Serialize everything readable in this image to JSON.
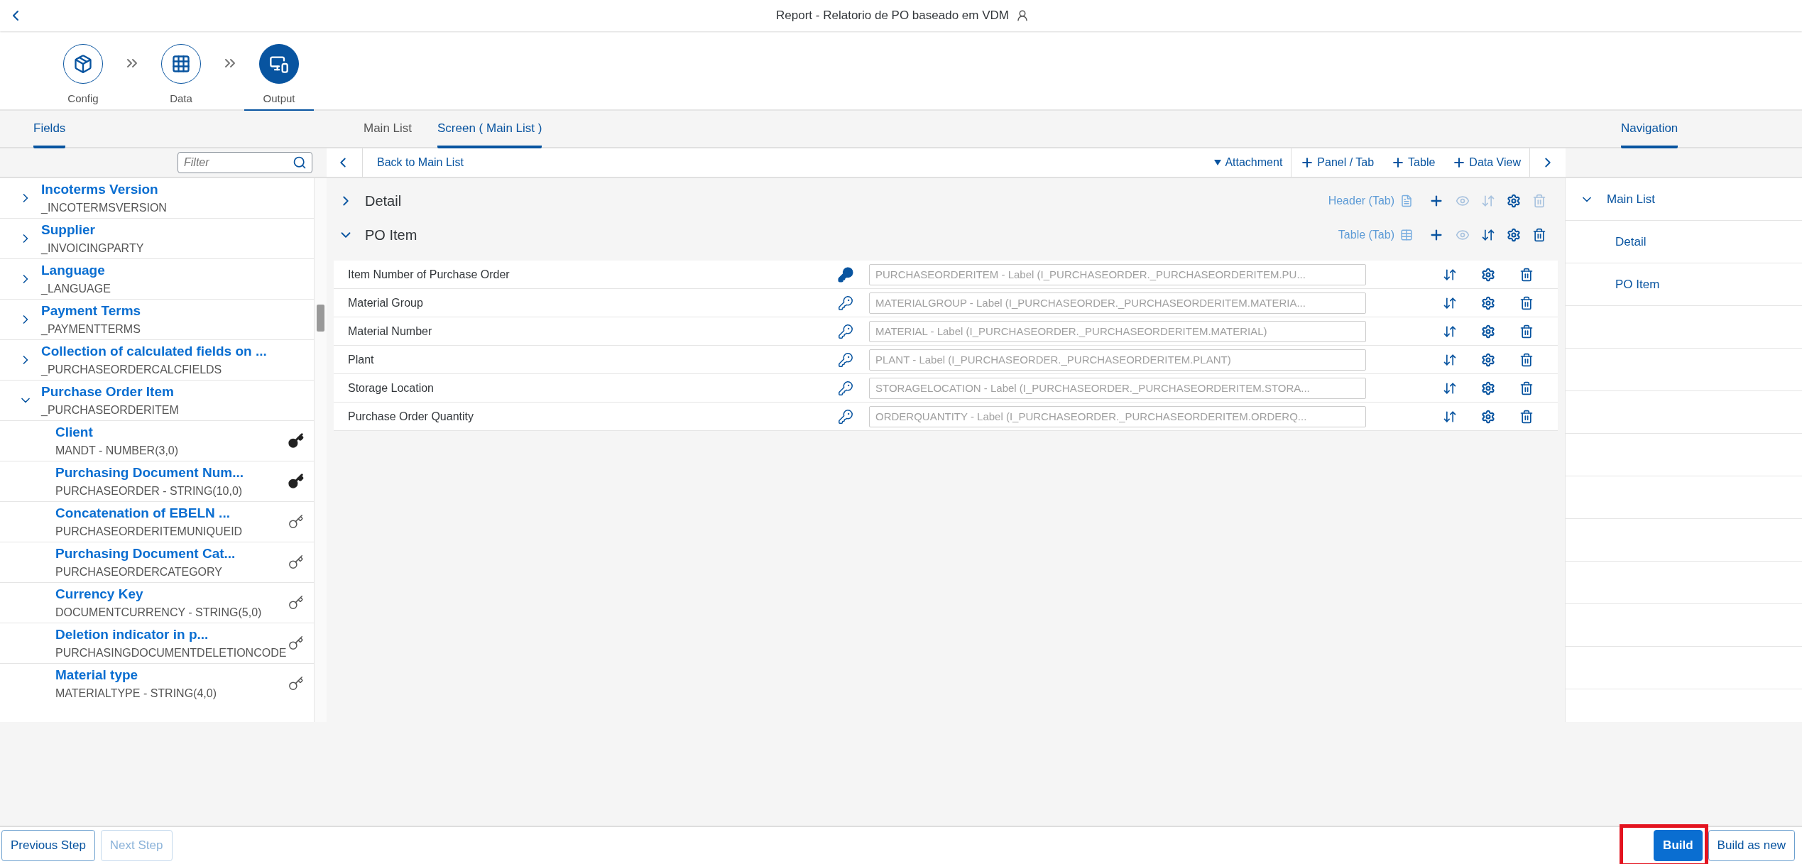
{
  "window": {
    "title": "Report - Relatorio de PO baseado em VDM"
  },
  "wizard": {
    "steps": [
      {
        "label": "Config",
        "selected": false
      },
      {
        "label": "Data",
        "selected": false
      },
      {
        "label": "Output",
        "selected": true
      }
    ]
  },
  "fields_panel": {
    "tab": {
      "label": "Fields",
      "selected": true
    },
    "filter": {
      "placeholder": "Filter"
    },
    "tree": [
      {
        "title": "Incoterms Version",
        "subtitle": "_INCOTERMSVERSION",
        "expanded": false
      },
      {
        "title": "Supplier",
        "subtitle": "_INVOICINGPARTY",
        "expanded": false
      },
      {
        "title": "Language",
        "subtitle": "_LANGUAGE",
        "expanded": false
      },
      {
        "title": "Payment Terms",
        "subtitle": "_PAYMENTTERMS",
        "expanded": false
      },
      {
        "title": "Collection of calculated fields on ...",
        "subtitle": "_PURCHASEORDERCALCFIELDS",
        "expanded": false
      },
      {
        "title": "Purchase Order Item",
        "subtitle": "_PURCHASEORDERITEM",
        "expanded": true,
        "children": [
          {
            "title": "Client",
            "subtitle": "MANDT - NUMBER(3,0)",
            "is_key": true
          },
          {
            "title": "Purchasing Document Num...",
            "subtitle": "PURCHASEORDER - STRING(10,0)",
            "is_key": true
          },
          {
            "title": "Concatenation of EBELN ...",
            "subtitle": "PURCHASEORDERITEMUNIQUEID",
            "is_key": false
          },
          {
            "title": "Purchasing Document Cat...",
            "subtitle": "PURCHASEORDERCATEGORY",
            "is_key": false
          },
          {
            "title": "Currency Key",
            "subtitle": "DOCUMENTCURRENCY - STRING(5,0)",
            "is_key": false
          },
          {
            "title": "Deletion indicator in p...",
            "subtitle": "PURCHASINGDOCUMENTDELETIONCODE",
            "is_key": false
          },
          {
            "title": "Material type",
            "subtitle": "MATERIALTYPE - STRING(4,0)",
            "is_key": false
          }
        ]
      }
    ]
  },
  "screen_panel": {
    "tabs": [
      {
        "label": "Main List",
        "selected": false
      },
      {
        "label": "Screen ( Main List )",
        "selected": true
      }
    ],
    "toolbar": {
      "back_link": "Back to Main List",
      "actions": [
        {
          "label": "Attachment",
          "kind": "dropdown"
        },
        {
          "label": "Panel / Tab",
          "kind": "add"
        },
        {
          "label": "Table",
          "kind": "add"
        },
        {
          "label": "Data View",
          "kind": "add"
        }
      ]
    },
    "sections": [
      {
        "title": "Detail",
        "expanded": false,
        "type_label": "Header (Tab)",
        "kind": "header",
        "sort_enabled": false,
        "delete_enabled": false
      },
      {
        "title": "PO Item",
        "expanded": true,
        "type_label": "Table (Tab)",
        "kind": "table",
        "sort_enabled": true,
        "delete_enabled": true,
        "rows": [
          {
            "label": "Item Number of Purchase Order",
            "is_key": true,
            "placeholder": "PURCHASEORDERITEM - Label (I_PURCHASEORDER._PURCHASEORDERITEM.PU..."
          },
          {
            "label": "Material Group",
            "is_key": false,
            "placeholder": "MATERIALGROUP - Label (I_PURCHASEORDER._PURCHASEORDERITEM.MATERIA..."
          },
          {
            "label": "Material Number",
            "is_key": false,
            "placeholder": "MATERIAL - Label (I_PURCHASEORDER._PURCHASEORDERITEM.MATERIAL)"
          },
          {
            "label": "Plant",
            "is_key": false,
            "placeholder": "PLANT - Label (I_PURCHASEORDER._PURCHASEORDERITEM.PLANT)"
          },
          {
            "label": "Storage Location",
            "is_key": false,
            "placeholder": "STORAGELOCATION - Label (I_PURCHASEORDER._PURCHASEORDERITEM.STORA..."
          },
          {
            "label": "Purchase Order Quantity",
            "is_key": false,
            "placeholder": "ORDERQUANTITY - Label (I_PURCHASEORDER._PURCHASEORDERITEM.ORDERQ..."
          }
        ]
      }
    ]
  },
  "navigation_panel": {
    "tab": {
      "label": "Navigation",
      "selected": true
    },
    "tree": [
      {
        "label": "Main List",
        "expanded": true,
        "children": [
          {
            "label": "Detail"
          },
          {
            "label": "PO Item"
          }
        ]
      }
    ]
  },
  "footer": {
    "left_buttons": [
      {
        "label": "Previous Step",
        "disabled": false
      },
      {
        "label": "Next Step",
        "disabled": true
      }
    ],
    "right_buttons": [
      {
        "label": "Build",
        "kind": "primary",
        "highlighted": true
      },
      {
        "label": "Build as new",
        "kind": "secondary",
        "highlighted": false
      }
    ]
  }
}
